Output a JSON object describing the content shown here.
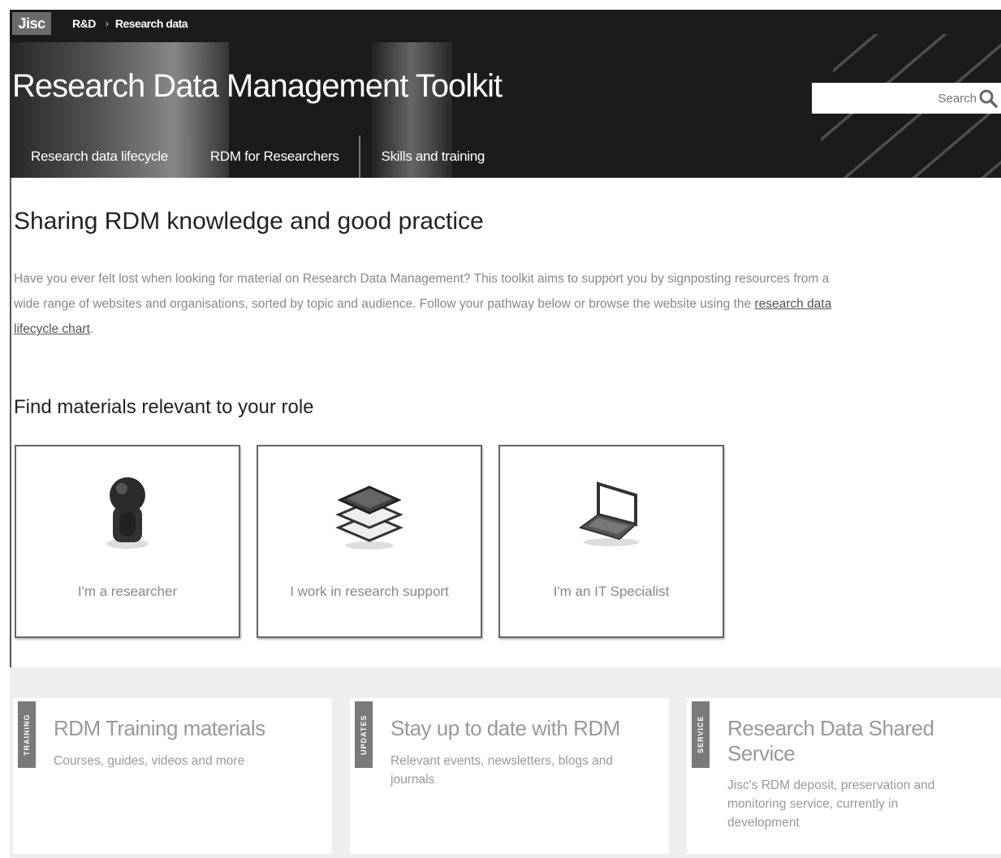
{
  "header": {
    "logo": "Jisc",
    "breadcrumb": [
      "R&D",
      "Research data"
    ],
    "breadcrumb_separator": "›",
    "site_title": "Research Data Management Toolkit",
    "search_placeholder": "Search",
    "nav": [
      "Research data lifecycle",
      "RDM for Researchers",
      "Skills and training"
    ]
  },
  "main": {
    "title": "Sharing RDM knowledge and good practice",
    "intro_text": "Have you ever felt lost when looking for material on Research Data Management? This toolkit aims to support you by signposting resources from a wide range of websites and organisations, sorted by topic and audience. Follow your pathway below or browse the website using the ",
    "intro_link": "research data lifecycle chart",
    "intro_end": ".",
    "roles_title": "Find materials relevant to your role",
    "roles": [
      {
        "label": "I'm a researcher",
        "icon": "researcher-icon"
      },
      {
        "label": "I work in research support",
        "icon": "books-icon"
      },
      {
        "label": "I'm an IT Specialist",
        "icon": "laptop-icon"
      }
    ]
  },
  "promos": [
    {
      "tag": "TRAINING",
      "title": "RDM Training materials",
      "desc": "Courses, guides, videos and more"
    },
    {
      "tag": "UPDATES",
      "title": "Stay up to date with RDM",
      "desc": "Relevant events, newsletters, blogs and journals"
    },
    {
      "tag": "SERVICE",
      "title": "Research Data Shared Service",
      "desc": "Jisc's RDM deposit, preservation and monitoring service, currently in development"
    }
  ]
}
